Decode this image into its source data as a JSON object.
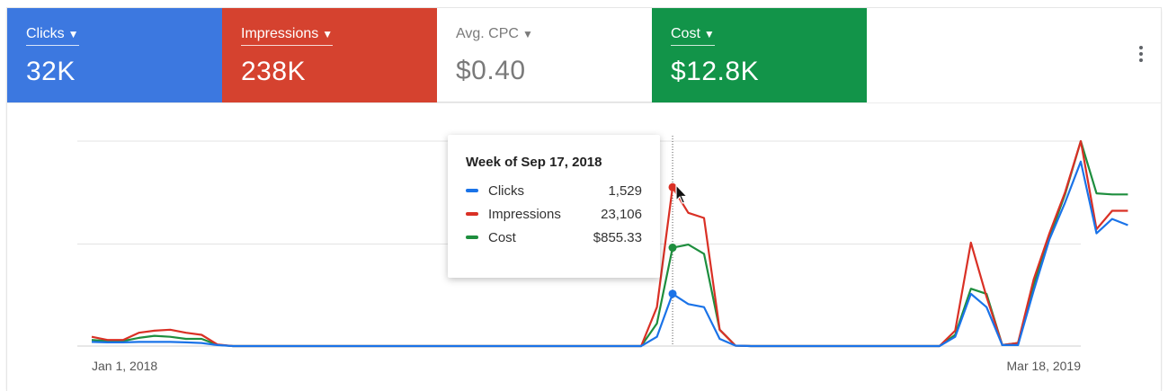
{
  "metrics": [
    {
      "label": "Clicks",
      "value": "32K",
      "color": "#3c78e0"
    },
    {
      "label": "Impressions",
      "value": "238K",
      "color": "#d5422f"
    },
    {
      "label": "Avg. CPC",
      "value": "$0.40",
      "color": "#ffffff"
    },
    {
      "label": "Cost",
      "value": "$12.8K",
      "color": "#129449"
    }
  ],
  "more_icon": "more-vert-icon",
  "tooltip": {
    "title": "Week of Sep 17, 2018",
    "rows": [
      {
        "name": "Clicks",
        "value": "1,529",
        "color": "#1a73e8"
      },
      {
        "name": "Impressions",
        "value": "23,106",
        "color": "#d93025"
      },
      {
        "name": "Cost",
        "value": "$855.33",
        "color": "#1e8e3e"
      }
    ]
  },
  "chart_data": {
    "type": "line",
    "xlabel": "",
    "ylabel": "",
    "x_tick_labels": [
      "Jan 1, 2018",
      "Mar 18, 2019"
    ],
    "x": [
      "2018-01-01",
      "2018-01-08",
      "2018-01-15",
      "2018-01-22",
      "2018-01-29",
      "2018-02-05",
      "2018-02-12",
      "2018-02-19",
      "2018-02-26",
      "2018-03-05",
      "2018-03-12",
      "2018-03-19",
      "2018-03-26",
      "2018-04-02",
      "2018-04-09",
      "2018-04-16",
      "2018-04-23",
      "2018-04-30",
      "2018-05-07",
      "2018-05-14",
      "2018-05-21",
      "2018-05-28",
      "2018-06-04",
      "2018-06-11",
      "2018-06-18",
      "2018-06-25",
      "2018-07-02",
      "2018-07-09",
      "2018-07-16",
      "2018-07-23",
      "2018-07-30",
      "2018-08-06",
      "2018-08-13",
      "2018-08-20",
      "2018-08-27",
      "2018-09-03",
      "2018-09-10",
      "2018-09-17",
      "2018-09-24",
      "2018-10-01",
      "2018-10-08",
      "2018-10-15",
      "2018-10-22",
      "2018-10-29",
      "2018-11-05",
      "2018-11-12",
      "2018-11-19",
      "2018-11-26",
      "2018-12-03",
      "2018-12-10",
      "2018-12-17",
      "2018-12-24",
      "2018-12-31",
      "2019-01-07",
      "2019-01-14",
      "2019-01-21",
      "2019-01-28",
      "2019-02-04",
      "2019-02-11",
      "2019-02-18",
      "2019-02-25",
      "2019-03-04",
      "2019-03-11",
      "2019-03-18"
    ],
    "series": [
      {
        "name": "Clicks",
        "color": "#1a73e8",
        "values": [
          2.0,
          1.8,
          1.8,
          2.0,
          2.0,
          2.0,
          1.8,
          1.5,
          0.5,
          0.0,
          0.0,
          0.0,
          0.0,
          0.0,
          0.0,
          0.0,
          0.0,
          0.0,
          0.0,
          0.0,
          0.0,
          0.0,
          0.0,
          0.0,
          0.0,
          0.0,
          0.0,
          0.0,
          0.0,
          0.0,
          0.0,
          0.0,
          0.0,
          0.0,
          0.0,
          0.0,
          4.5,
          25.5,
          20.5,
          19.0,
          3.5,
          0.2,
          0.0,
          0.0,
          0.0,
          0.0,
          0.0,
          0.0,
          0.0,
          0.0,
          0.0,
          0.0,
          0.0,
          0.0,
          0.0,
          4.5,
          25.5,
          19.0,
          0.5,
          0.5,
          27.0,
          52.0,
          70.0,
          90.0,
          55.0,
          62.0,
          59.0
        ]
      },
      {
        "name": "Impressions",
        "color": "#d93025",
        "values": [
          4.5,
          3.0,
          3.0,
          6.5,
          7.5,
          8.0,
          6.5,
          5.5,
          0.8,
          0.0,
          0.0,
          0.0,
          0.0,
          0.0,
          0.0,
          0.0,
          0.0,
          0.0,
          0.0,
          0.0,
          0.0,
          0.0,
          0.0,
          0.0,
          0.0,
          0.0,
          0.0,
          0.0,
          0.0,
          0.0,
          0.0,
          0.0,
          0.0,
          0.0,
          0.0,
          0.0,
          19.0,
          77.5,
          65.0,
          62.5,
          8.0,
          0.2,
          0.0,
          0.0,
          0.0,
          0.0,
          0.0,
          0.0,
          0.0,
          0.0,
          0.0,
          0.0,
          0.0,
          0.0,
          0.0,
          7.5,
          50.5,
          24.0,
          0.5,
          1.5,
          32.5,
          55.0,
          75.0,
          100.0,
          57.0,
          66.0,
          66.0
        ]
      },
      {
        "name": "Cost",
        "color": "#1e8e3e",
        "values": [
          3.0,
          2.5,
          2.5,
          4.0,
          5.0,
          4.5,
          3.5,
          3.5,
          0.6,
          0.0,
          0.0,
          0.0,
          0.0,
          0.0,
          0.0,
          0.0,
          0.0,
          0.0,
          0.0,
          0.0,
          0.0,
          0.0,
          0.0,
          0.0,
          0.0,
          0.0,
          0.0,
          0.0,
          0.0,
          0.0,
          0.0,
          0.0,
          0.0,
          0.0,
          0.0,
          0.0,
          11.0,
          48.0,
          49.5,
          45.0,
          8.0,
          0.2,
          0.0,
          0.0,
          0.0,
          0.0,
          0.0,
          0.0,
          0.0,
          0.0,
          0.0,
          0.0,
          0.0,
          0.0,
          0.0,
          5.5,
          28.0,
          25.5,
          0.5,
          1.5,
          30.0,
          53.0,
          74.0,
          100.0,
          74.5,
          74.0,
          74.0
        ]
      }
    ],
    "y_gridlines": 3,
    "highlight_x": "2018-09-17",
    "legend": "none"
  }
}
